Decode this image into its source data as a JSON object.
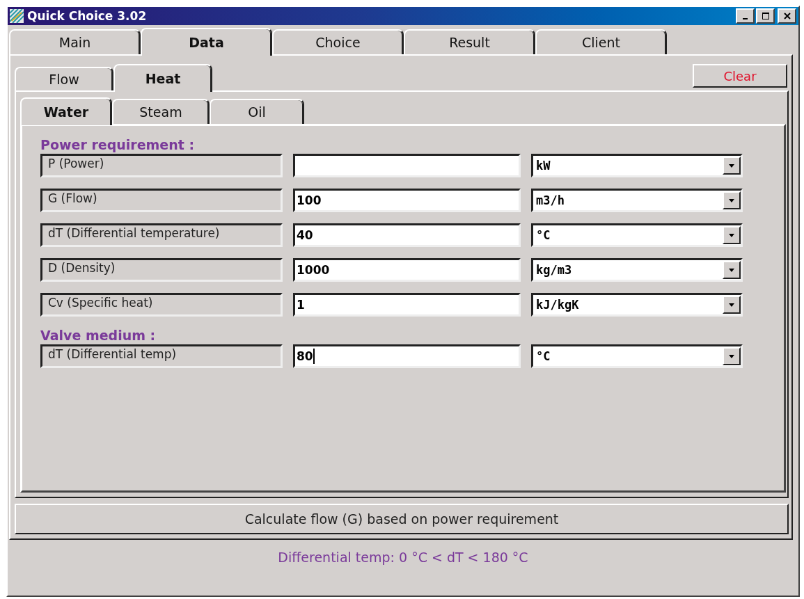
{
  "window": {
    "title": "Quick Choice 3.02"
  },
  "tabs": [
    {
      "label": "Main",
      "selected": false
    },
    {
      "label": "Data",
      "selected": true
    },
    {
      "label": "Choice",
      "selected": false
    },
    {
      "label": "Result",
      "selected": false
    },
    {
      "label": "Client",
      "selected": false
    }
  ],
  "subtabs": [
    {
      "label": "Flow",
      "selected": false
    },
    {
      "label": "Heat",
      "selected": true
    }
  ],
  "clear_button": "Clear",
  "medium_tabs": [
    {
      "label": "Water",
      "selected": true
    },
    {
      "label": "Steam",
      "selected": false
    },
    {
      "label": "Oil",
      "selected": false
    }
  ],
  "sections": [
    {
      "heading": "Power requirement :",
      "rows": [
        {
          "label": "P (Power)",
          "value": "",
          "unit": "kW",
          "focused": false
        },
        {
          "label": "G (Flow)",
          "value": "100",
          "unit": "m3/h",
          "focused": false
        },
        {
          "label": "dT (Differential temperature)",
          "value": "40",
          "unit": "°C",
          "focused": false
        },
        {
          "label": "D (Density)",
          "value": "1000",
          "unit": "kg/m3",
          "focused": false
        },
        {
          "label": "Cv (Specific heat)",
          "value": "1",
          "unit": "kJ/kgK",
          "focused": false
        }
      ]
    },
    {
      "heading": "Valve medium :",
      "rows": [
        {
          "label": "dT (Differential temp)",
          "value": "80",
          "unit": "°C",
          "focused": true
        }
      ]
    }
  ],
  "calculate_button": {
    "label": "Calculate flow (G) based on power requirement"
  },
  "status_bar": "Differential temp: 0 °C < dT < 180 °C"
}
